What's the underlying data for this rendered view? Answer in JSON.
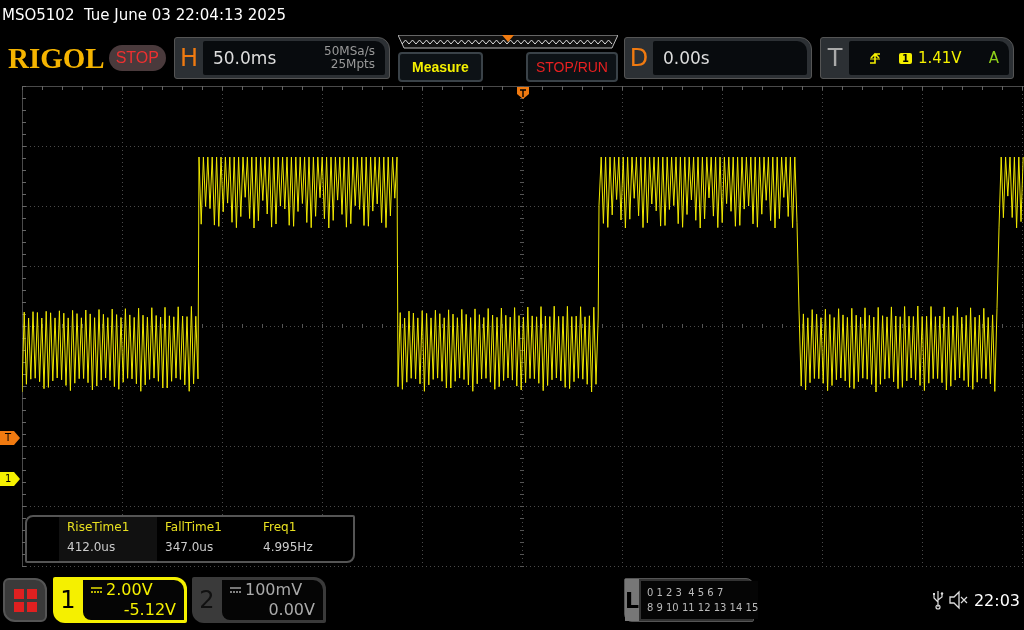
{
  "status_line": "MSO5102  Tue June 03 22:04:13 2025",
  "logo": "RIGOL",
  "run_state": {
    "label": "STOP"
  },
  "horizontal": {
    "key": "H",
    "timebase": "50.0ms",
    "sample_rate": "50MSa/s",
    "memory_depth": "25Mpts"
  },
  "buttons": [
    {
      "label": "Measure",
      "kind": "measure"
    },
    {
      "label": "STOP/RUN",
      "kind": "stoprun"
    }
  ],
  "delay": {
    "key": "D",
    "value": "0.00s"
  },
  "trigger": {
    "key": "T",
    "source": "1",
    "level": "1.41V",
    "mode": "A"
  },
  "markers": [
    {
      "label": "T",
      "kind": "trigger"
    },
    {
      "label": "1",
      "kind": "channel"
    }
  ],
  "measurements": [
    {
      "name": "RiseTime1",
      "value": "412.0us"
    },
    {
      "name": "FallTime1",
      "value": "347.0us"
    },
    {
      "name": "Freq1",
      "value": "4.995Hz"
    }
  ],
  "channels": [
    {
      "number": "1",
      "scale": "2.00V",
      "offset": "-5.12V",
      "on": true
    },
    {
      "number": "2",
      "scale": "100mV",
      "offset": "0.00V",
      "on": false
    }
  ],
  "logic": {
    "key": "L",
    "rows": [
      "0 1 2 3  4 5 6 7",
      "8 9 10 11 12 13 14 15"
    ]
  },
  "clock": "22:03"
}
